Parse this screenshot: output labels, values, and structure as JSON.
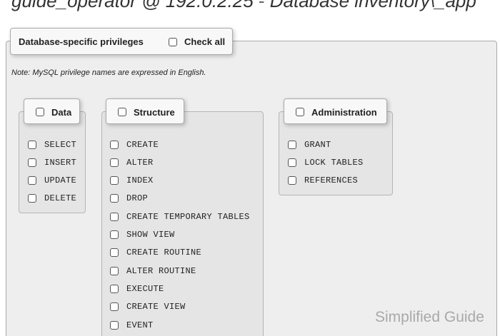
{
  "header": {
    "title_user": "guide_operator @ 192.0.2.25",
    "title_separator": " - ",
    "title_db": "Database inventory\\_app"
  },
  "privileges_section": {
    "legend_label": "Database-specific privileges",
    "check_all_label": "Check all",
    "note": "Note: MySQL privilege names are expressed in English."
  },
  "groups": {
    "data": {
      "label": "Data",
      "items": [
        "SELECT",
        "INSERT",
        "UPDATE",
        "DELETE"
      ]
    },
    "structure": {
      "label": "Structure",
      "items": [
        "CREATE",
        "ALTER",
        "INDEX",
        "DROP",
        "CREATE TEMPORARY TABLES",
        "SHOW VIEW",
        "CREATE ROUTINE",
        "ALTER ROUTINE",
        "EXECUTE",
        "CREATE VIEW",
        "EVENT"
      ]
    },
    "administration": {
      "label": "Administration",
      "items": [
        "GRANT",
        "LOCK TABLES",
        "REFERENCES"
      ]
    }
  },
  "watermark": "Simplified Guide"
}
